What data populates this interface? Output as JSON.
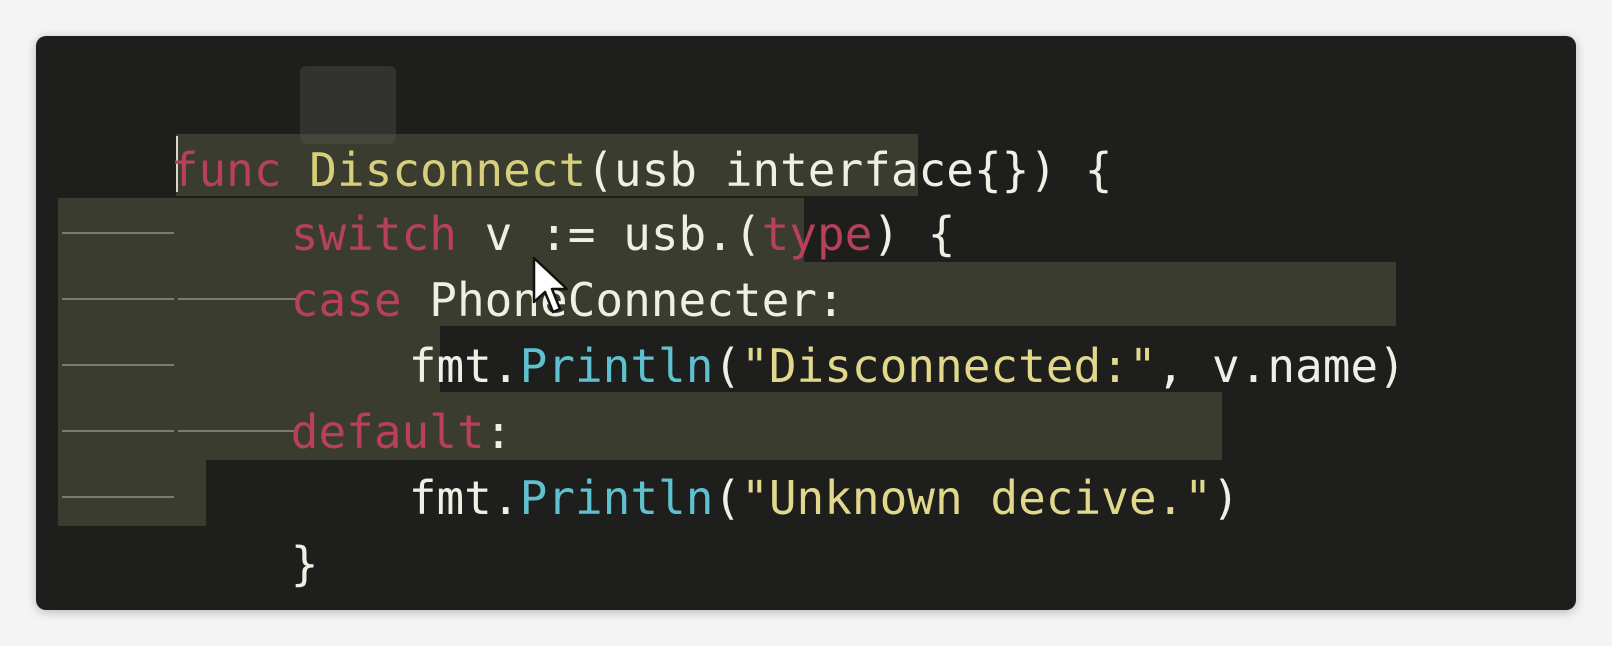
{
  "editor": {
    "language": "go",
    "colors": {
      "background": "#1e1f1c",
      "selection": "#3a3c30",
      "keyword": "#f0326d",
      "function": "#d7cf7a",
      "string": "#e2d88c",
      "method": "#5fc0cf",
      "text": "#f0efe6"
    },
    "lines": [
      {
        "t1": "func",
        "t2": " ",
        "t3": "Disconnect",
        "t4": "(usb interface{}) {"
      },
      {
        "t1": "switch",
        "t2": " v := usb.(",
        "t3": "type",
        "t4": ") {"
      },
      {
        "t1": "case",
        "t2": " PhoneConnecter:"
      },
      {
        "t1": "fmt.",
        "t2": "Println",
        "t3": "(",
        "t4": "\"Disconnected:\"",
        "t5": ", v.name)"
      },
      {
        "t1": "default",
        "t2": ":"
      },
      {
        "t1": "fmt.",
        "t2": "Println",
        "t3": "(",
        "t4": "\"Unknown decive.\"",
        "t5": ")"
      },
      {
        "t1": "}"
      },
      {
        "t1": "}"
      }
    ]
  }
}
